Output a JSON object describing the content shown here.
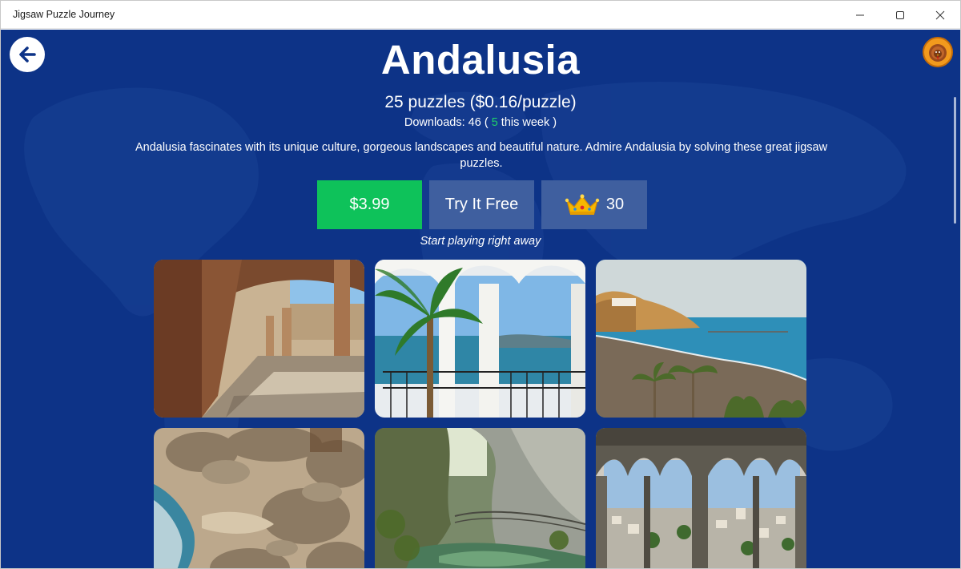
{
  "window": {
    "title": "Jigsaw Puzzle Journey"
  },
  "pack": {
    "title": "Andalusia",
    "puzzles_line": "25 puzzles ($0.16/puzzle)",
    "downloads_prefix": "Downloads: 46 (",
    "downloads_week_count": "5",
    "downloads_suffix": " this week )",
    "description": "Andalusia fascinates with its unique culture, gorgeous landscapes and beautiful nature. Admire Andalusia by solving these great jigsaw puzzles.",
    "hint": "Start playing right away"
  },
  "actions": {
    "price_label": "$3.99",
    "try_label": "Try It Free",
    "crown_count": "30"
  },
  "icons": {
    "back": "arrow-left-icon",
    "crown": "crown-icon",
    "avatar": "turkey-avatar"
  },
  "colors": {
    "background": "#0d3387",
    "price_button": "#0ec25a",
    "secondary_button": "#3f5f9f",
    "accent_green": "#1fd06a"
  },
  "puzzles": [
    {
      "subject": "arcade-courtyard"
    },
    {
      "subject": "palm-arches-sea"
    },
    {
      "subject": "coastal-beach"
    },
    {
      "subject": "rocky-shore"
    },
    {
      "subject": "canyon-walkway"
    },
    {
      "subject": "moorish-window-view"
    }
  ]
}
